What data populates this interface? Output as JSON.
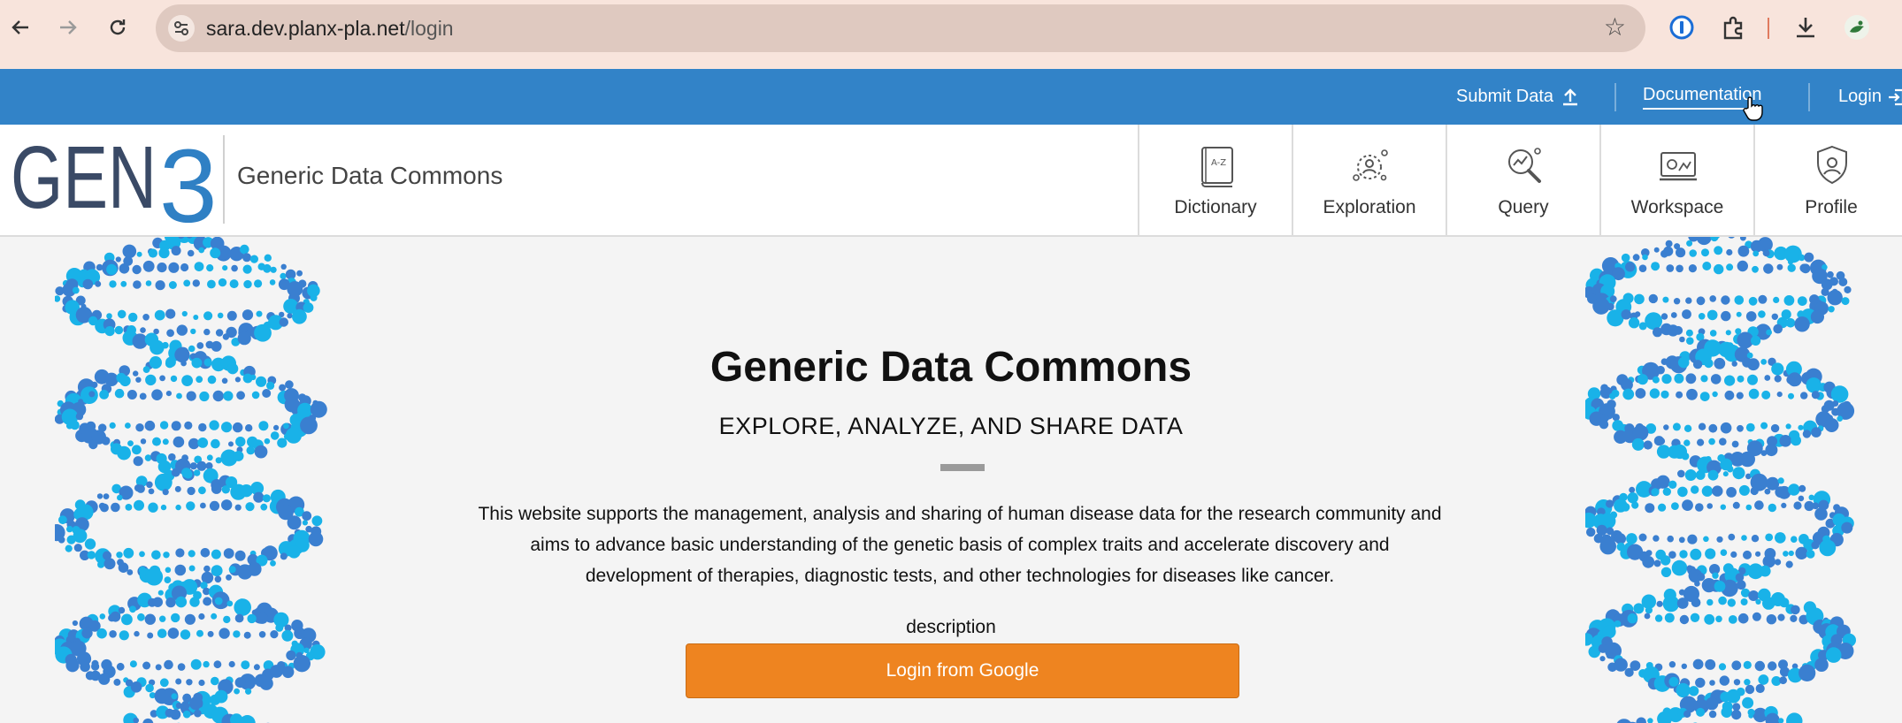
{
  "browser": {
    "url_host": "sara.dev.planx-pla.net",
    "url_path": "/login",
    "back_icon": "arrow-left",
    "forward_icon": "arrow-right",
    "reload_icon": "reload"
  },
  "topnav": {
    "items": [
      {
        "label": "Submit Data",
        "icon": "upload-icon"
      },
      {
        "label": "Documentation"
      },
      {
        "label": "Login",
        "icon": "login-icon"
      }
    ]
  },
  "header": {
    "brand": "Generic Data Commons",
    "logo_text": "GEN3",
    "tabs": [
      {
        "label": "Dictionary",
        "icon": "dictionary-icon"
      },
      {
        "label": "Exploration",
        "icon": "exploration-icon"
      },
      {
        "label": "Query",
        "icon": "query-icon"
      },
      {
        "label": "Workspace",
        "icon": "workspace-icon"
      },
      {
        "label": "Profile",
        "icon": "profile-icon"
      }
    ]
  },
  "main": {
    "title": "Generic Data Commons",
    "subtitle": "EXPLORE, ANALYZE, AND SHARE DATA",
    "description": "This website supports the management, analysis and sharing of human disease data for the research community and aims to advance basic understanding of the genetic basis of complex traits and accelerate discovery and development of therapies, diagnostic tests, and other technologies for diseases like cancer.",
    "login_label": "description",
    "login_button": "Login from Google"
  },
  "colors": {
    "topnav": "#3283c8",
    "accent_orange": "#ee8420",
    "logo_dark": "#3a4a66",
    "logo_blue": "#2f80c4",
    "dna_blue": "#3a7fd0",
    "dna_light": "#19b2e8"
  }
}
